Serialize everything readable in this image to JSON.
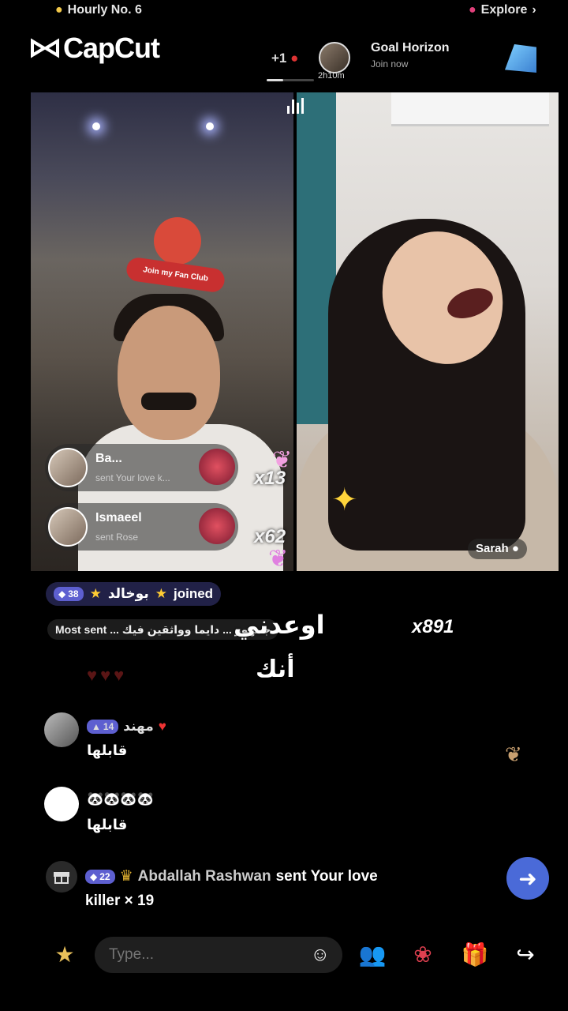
{
  "top": {
    "hourly_label": "Hourly No. 6",
    "explore_label": "Explore",
    "brand": "CapCut"
  },
  "host": {
    "plus_one": "+1",
    "duration": "2h10m",
    "goal_title": "Goal Horizon",
    "goal_action": "Join now"
  },
  "stream": {
    "fan_club_badge": "Join my Fan Club",
    "guest_name": "Sarah",
    "gift_cards": [
      {
        "name": "Ba...",
        "subtitle": "sent Your love k...",
        "combo": "x13"
      },
      {
        "name": "Ismaeel",
        "subtitle": "sent Rose",
        "combo": "x62"
      }
    ]
  },
  "chat": {
    "joined": {
      "level": "38",
      "name": "بوخالد",
      "status": "joined"
    },
    "most_sent": "Most sent ... جمهور ... دايما وواثقين فيك",
    "most_sent_count": "x891",
    "caption_line1": "اوعدني",
    "caption_line2": "أنك",
    "messages": [
      {
        "level": "14",
        "name": "مهند",
        "text": "قابلها"
      },
      {
        "level": "",
        "name": "🐼🐼🐼🐼",
        "text": "قابلها"
      }
    ],
    "system": {
      "level": "22",
      "name": "Abdallah Rashwan",
      "action": "sent Your love",
      "gift": "killer",
      "count": "× 19"
    }
  },
  "composer": {
    "placeholder": "Type..."
  },
  "colors": {
    "accent_blue": "#4a6ad8",
    "level_badge": "#5d5fd0",
    "gift_red": "#d94a3a"
  }
}
